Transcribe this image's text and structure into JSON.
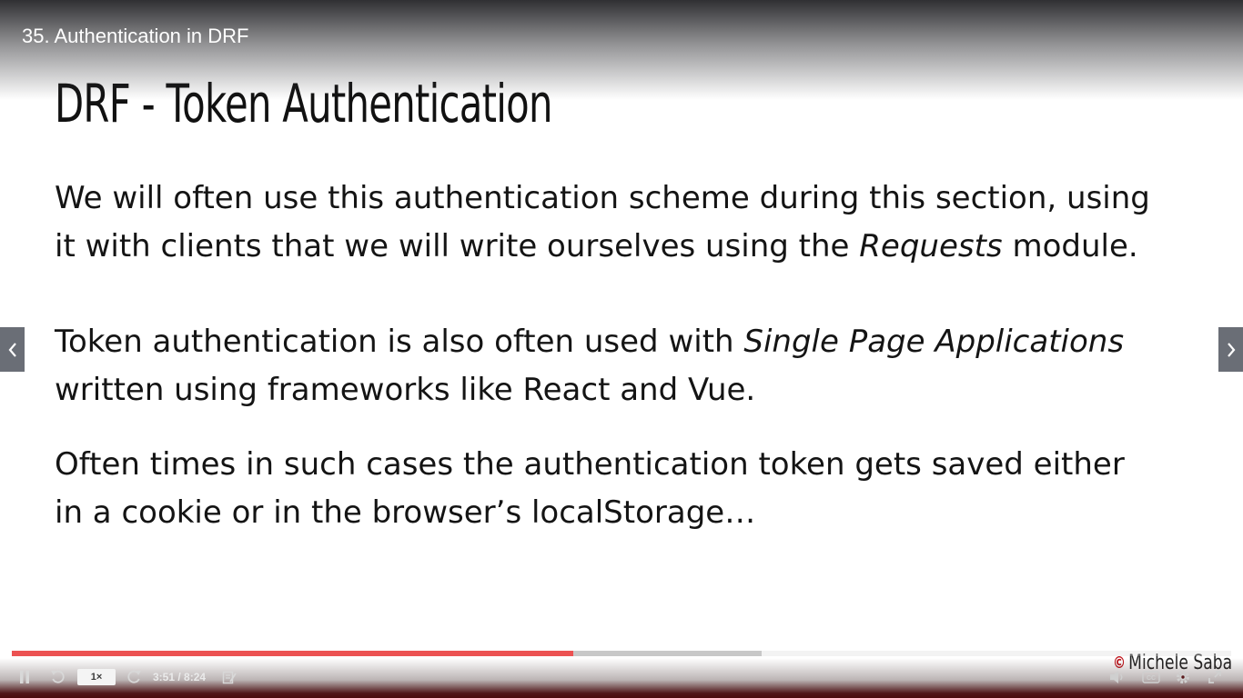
{
  "header": {
    "title": "35. Authentication in DRF"
  },
  "slide": {
    "heading": "DRF - Token Authentication",
    "paragraph1": {
      "line1": "We will often use this authentication scheme during this section, using",
      "line2_before": "it with clients that we will write ourselves using the ",
      "line2_emphasis": "Requests",
      "line2_after": " module."
    },
    "paragraph2": {
      "line1_before": "Token authentication is also often used with ",
      "line1_emphasis": "Single Page Applications",
      "line2": "written using frameworks like React and Vue."
    },
    "paragraph3": {
      "line1": "Often times in such cases the authentication token gets saved either",
      "line2": "in a cookie or in the browser’s localStorage…"
    },
    "watermark": {
      "copyright_symbol": "©",
      "author": "Michele Saba"
    }
  },
  "navigation": {
    "prev_icon": "chevron-left-icon",
    "next_icon": "chevron-right-icon"
  },
  "player": {
    "progress": {
      "played_fraction": 0.4604,
      "buffered_fraction": 0.6148
    },
    "speed_label": "1×",
    "time_display": "3:51 / 8:24",
    "icons": {
      "pause": "pause-icon",
      "rewind": "rewind-icon",
      "forward": "forward-icon",
      "notes": "notes-icon",
      "volume": "volume-icon",
      "cc": "cc-icon",
      "settings": "gear-icon",
      "fullscreen": "fullscreen-icon"
    }
  },
  "colors": {
    "progress_played": "#ec5252",
    "progress_buffered": "#c8c8c8",
    "watermark_symbol": "#c0141b"
  }
}
